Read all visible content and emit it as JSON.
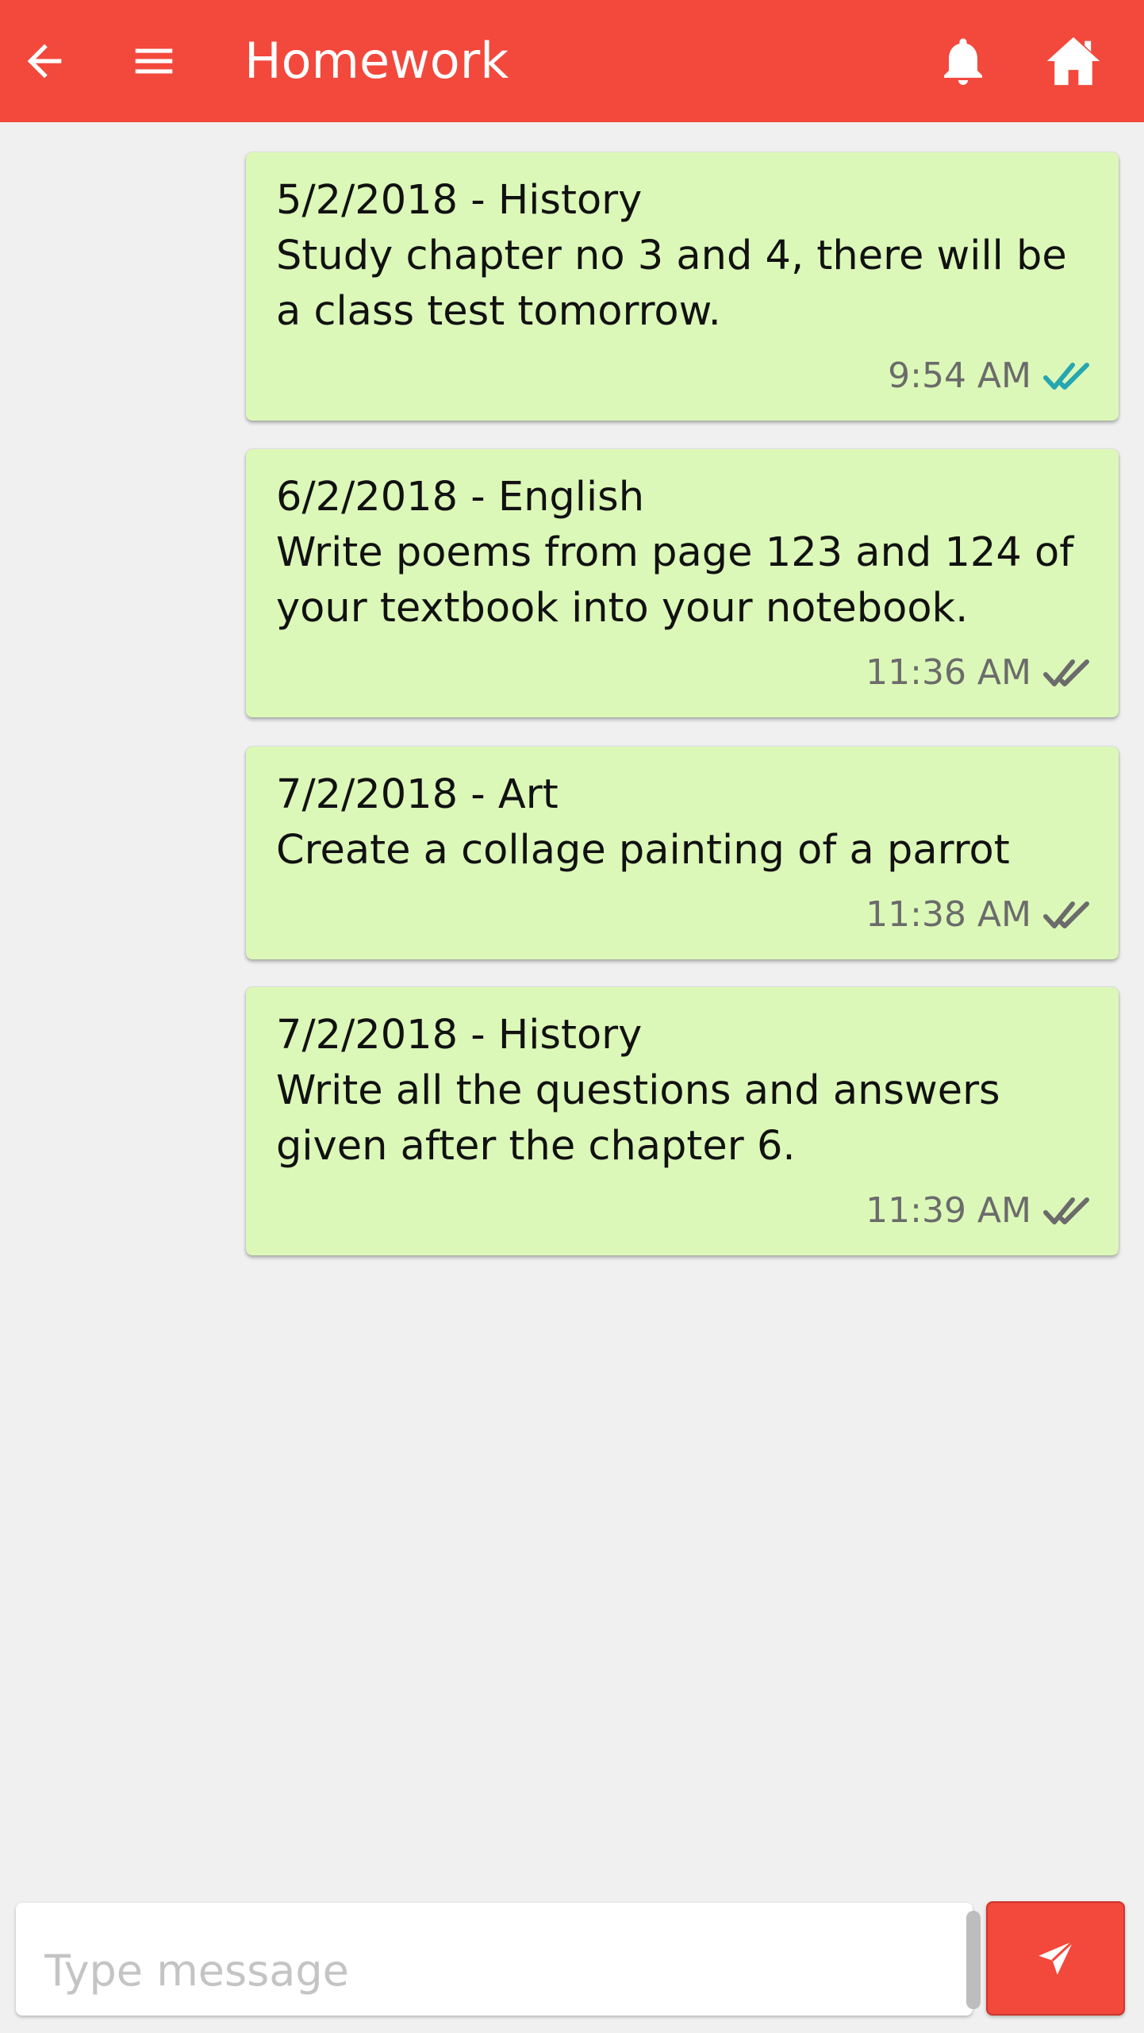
{
  "app": {
    "title": "Homework",
    "accent_color": "#f3483c",
    "bubble_color": "#dcf8b8"
  },
  "toolbar": {
    "back_icon": "arrow-left-icon",
    "menu_icon": "hamburger-menu-icon",
    "notifications_icon": "bell-icon",
    "home_icon": "home-icon"
  },
  "messages": [
    {
      "header": "5/2/2018 - History",
      "text": "Study chapter no 3 and 4, there will be a class test tomorrow.",
      "time": "9:54 AM",
      "status": "read",
      "tick_color": "#26a6b0"
    },
    {
      "header": "6/2/2018 - English",
      "text": "Write poems from page 123 and 124 of your textbook into your notebook.",
      "time": "11:36 AM",
      "status": "delivered",
      "tick_color": "#6b6b6b"
    },
    {
      "header": "7/2/2018 - Art",
      "text": "Create a collage painting of a parrot",
      "time": "11:38 AM",
      "status": "delivered",
      "tick_color": "#6b6b6b"
    },
    {
      "header": "7/2/2018 - History",
      "text": "Write all the questions and answers given after the chapter 6.",
      "time": "11:39 AM",
      "status": "delivered",
      "tick_color": "#6b6b6b"
    }
  ],
  "composer": {
    "placeholder": "Type message",
    "value": "",
    "send_icon": "send-icon"
  }
}
